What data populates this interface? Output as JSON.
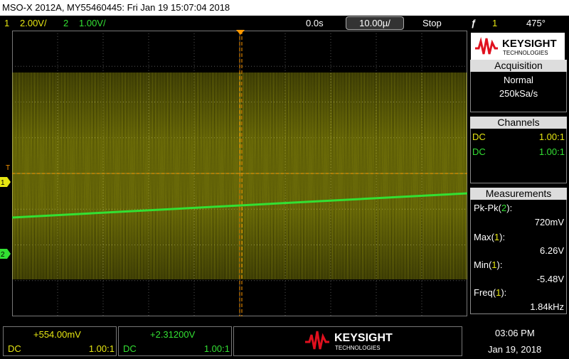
{
  "title_bar": {
    "text": "MSO-X 2012A, MY55460445: Fri Jan 19 15:07:04 2018"
  },
  "top_bar": {
    "ch1_num": "1",
    "ch1_scale": "2.00V/",
    "ch2_num": "2",
    "ch2_scale": "1.00V/",
    "time_offset": "0.0s",
    "timebase": "10.00µ/",
    "run_state": "Stop",
    "trigger_icon": "ƒ",
    "trigger_channel": "1",
    "trigger_level": "475°"
  },
  "logo": {
    "brand": "KEYSIGHT",
    "sub": "TECHNOLOGIES"
  },
  "acquisition": {
    "header": "Acquisition",
    "mode": "Normal",
    "rate": "250kSa/s"
  },
  "channels": {
    "header": "Channels",
    "rows": [
      {
        "coupling": "DC",
        "ratio": "1.00:1"
      },
      {
        "coupling": "DC",
        "ratio": "1.00:1"
      }
    ]
  },
  "measurements": {
    "header": "Measurements",
    "items": [
      {
        "label": "Pk-Pk",
        "channel": "2",
        "value": "720mV"
      },
      {
        "label": "Max",
        "channel": "1",
        "value": "6.26V"
      },
      {
        "label": "Min",
        "channel": "1",
        "value": "-5.48V"
      },
      {
        "label": "Freq",
        "channel": "1",
        "value": "1.84kHz"
      }
    ]
  },
  "markers": {
    "trigger": "T",
    "ch1": "1",
    "ch2": "2"
  },
  "bottom": {
    "ch1_offset": "+554.00mV",
    "ch1_coupling": "DC",
    "ch1_ratio": "1.00:1",
    "ch2_offset": "+2.31200V",
    "ch2_coupling": "DC",
    "ch2_ratio": "1.00:1",
    "time": "03:06 PM",
    "date": "Jan 19, 2018"
  },
  "colors": {
    "ch1": "#e6e612",
    "ch2": "#33e033",
    "trigger": "#ff9900",
    "grid": "#555555"
  }
}
